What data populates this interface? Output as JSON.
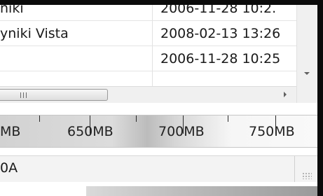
{
  "file_list": {
    "rows": [
      {
        "name": "niki",
        "date": "2006-11-28 10:2."
      },
      {
        "name": "yniki Vista",
        "date": "2008-02-13 13:26"
      },
      {
        "name": "",
        "date": "2006-11-28 10:25"
      }
    ]
  },
  "ruler": {
    "labels": [
      "MB",
      "650MB",
      "700MB",
      "750MB"
    ]
  },
  "status": {
    "text": "0A"
  },
  "icons": {
    "scroll_down": "chevron-down-icon",
    "scroll_right": "chevron-right-icon",
    "thumb_grip": "grip-icon",
    "size_grip": "resize-grip-icon"
  }
}
